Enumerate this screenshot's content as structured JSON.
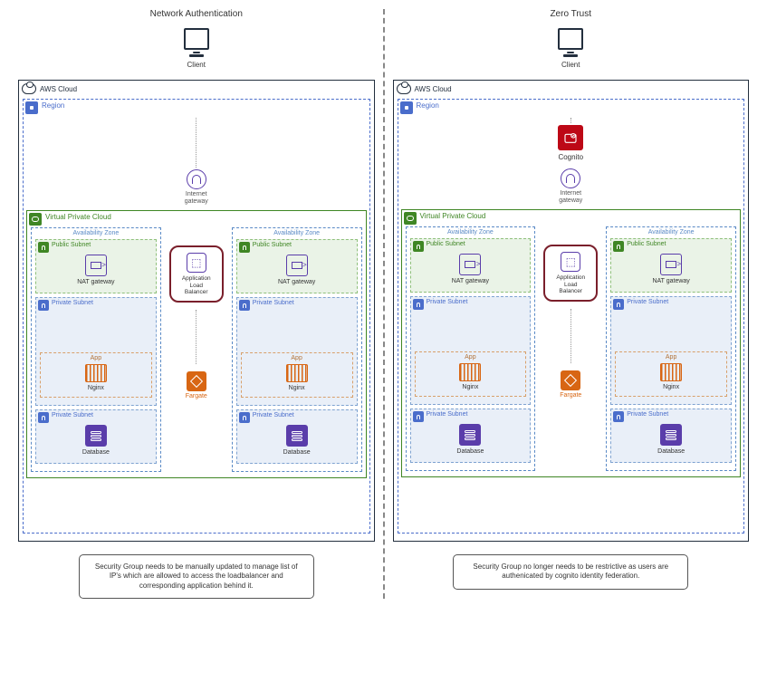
{
  "titles": {
    "left": "Network Authentication",
    "right": "Zero Trust"
  },
  "client_label": "Client",
  "cloud_label": "AWS Cloud",
  "region_label": "Region",
  "vpc_label": "Virtual Private Cloud",
  "az_label": "Availability Zone",
  "public_subnet_label": "Public Subnet",
  "private_subnet_label": "Private Subnet",
  "nat_label": "NAT gateway",
  "igw_label": "Internet\ngateway",
  "alb_label": "Application\nLoad\nBalancer",
  "fargate_label": "Fargate",
  "app_label": "App",
  "nginx_label": "Nginx",
  "db_label": "Database",
  "cognito_label": "Cognito",
  "notes": {
    "left": "Security Group needs to be manually updated to manage list of IP's which are allowed to access the loadbalancer and corresponding application behind it.",
    "right": "Security Group no longer needs to be restrictive as users are authenicated by cognito identity federation."
  }
}
